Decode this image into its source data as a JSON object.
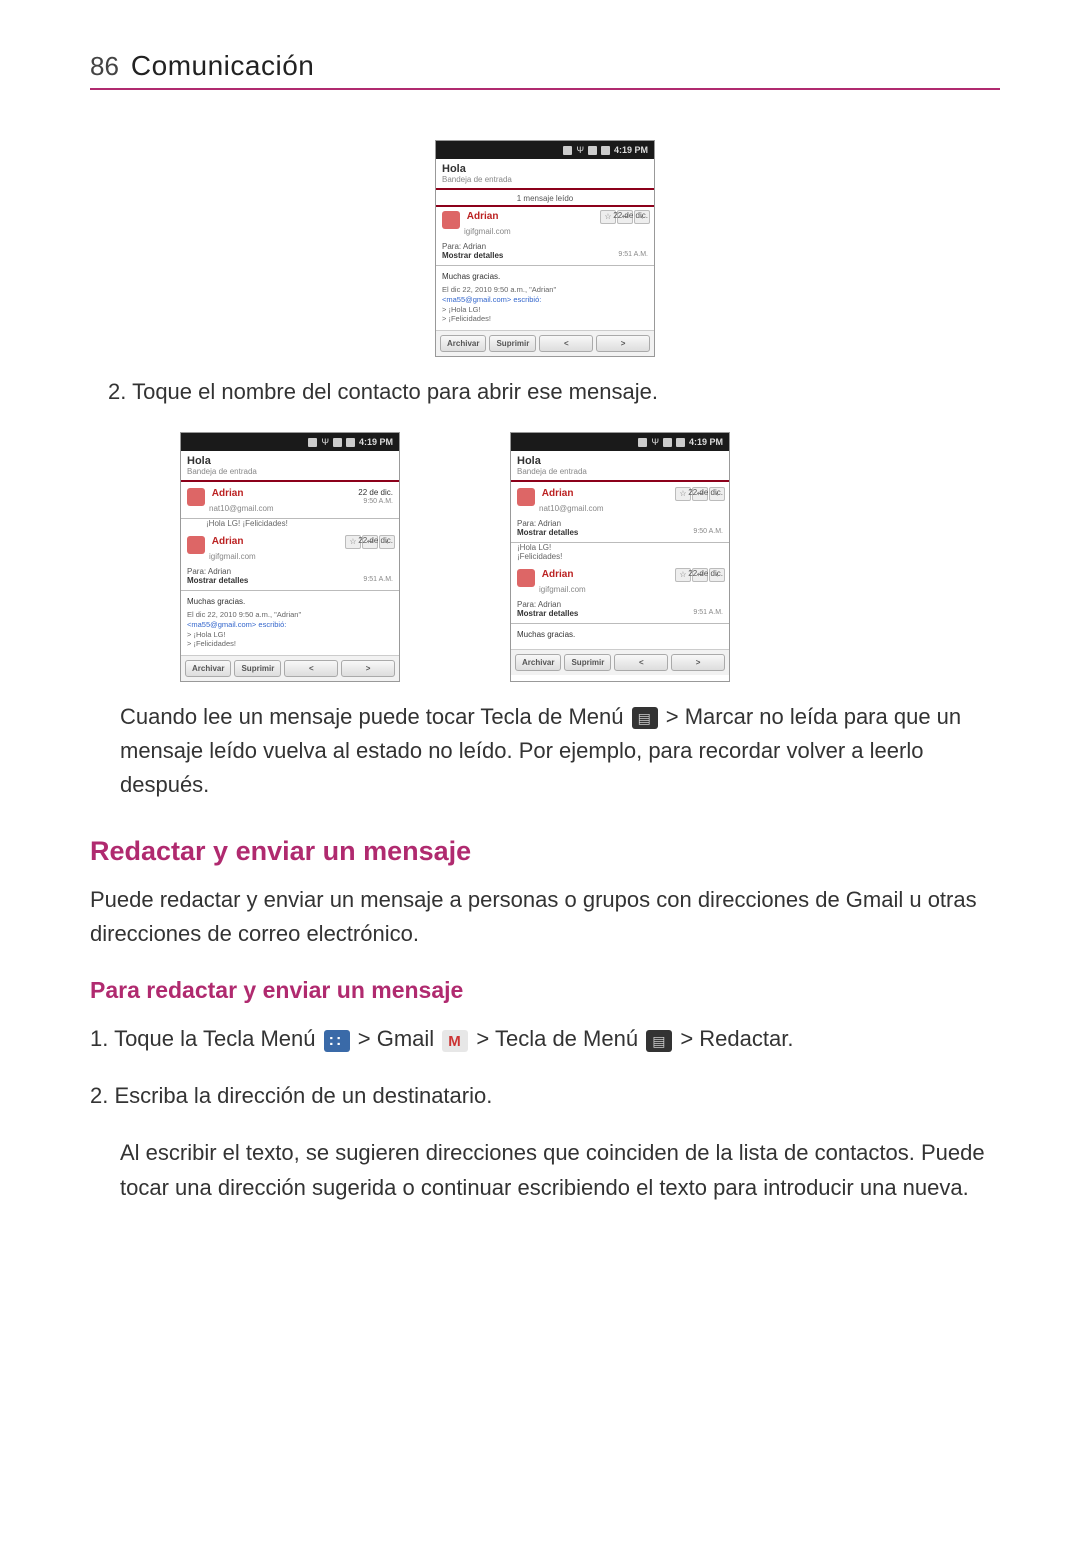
{
  "page": {
    "number": "86",
    "title": "Comunicación"
  },
  "steps": {
    "step2_label": "2.",
    "step2_text": "Toque el nombre del contacto para abrir ese mensaje."
  },
  "body": {
    "para1_a": "Cuando lee un mensaje puede tocar ",
    "para1_b": "Tecla de Menú",
    "para1_c": " > ",
    "para1_d": "Marcar no leída",
    "para1_e": " para que un mensaje leído vuelva al estado no leído. Por ejemplo, para recordar volver a leerlo después."
  },
  "section": {
    "h2": "Redactar y enviar un mensaje",
    "p1": "Puede redactar y enviar un mensaje a personas o grupos con direcciones de Gmail u otras direcciones de correo electrónico.",
    "h3": "Para redactar y enviar un mensaje"
  },
  "list": {
    "i1_a": "1.  Toque la ",
    "i1_b": "Tecla Menú",
    "i1_c": " > ",
    "i1_d": "Gmail",
    "i1_e": " > ",
    "i1_f": "Tecla de Menú",
    "i1_g": " > ",
    "i1_h": "Redactar",
    "i1_i": ".",
    "i2": "2.  Escriba la dirección de un destinatario.",
    "i2_desc": "Al escribir el texto, se sugieren direcciones que coinciden de la lista de contactos. Puede tocar una dirección sugerida o continuar escribiendo el texto para introducir una nueva."
  },
  "phone": {
    "time": "4:19 PM",
    "thread_title": "Hola",
    "folder": "Bandeja de entrada",
    "read_count": "1 mensaje leído",
    "from_name": "Adrian",
    "from_email1": "igifgmail.com",
    "from_email2": "nat10@gmail.com",
    "date": "22 de dic.",
    "msg_time1": "9:51 A.M.",
    "msg_time2": "9:50 A.M.",
    "to": "Para: Adrian",
    "show_details": "Mostrar detalles",
    "greeting": "Muchas gracias.",
    "quoted_line1": "El dic 22, 2010 9:50 a.m., \"Adrian\"",
    "quoted_line2": "<ma55@gmail.com> escribió:",
    "quoted_line3": "> ¡Hola LG!",
    "quoted_line4": "> ¡Felicidades!",
    "archive": "Archivar",
    "delete": "Suprimir",
    "prev": "<",
    "next": ">",
    "preview_text": "¡Hola LG! ¡Felicidades!",
    "preview_text2": "¡Hola LG!\n¡Felicidades!"
  }
}
